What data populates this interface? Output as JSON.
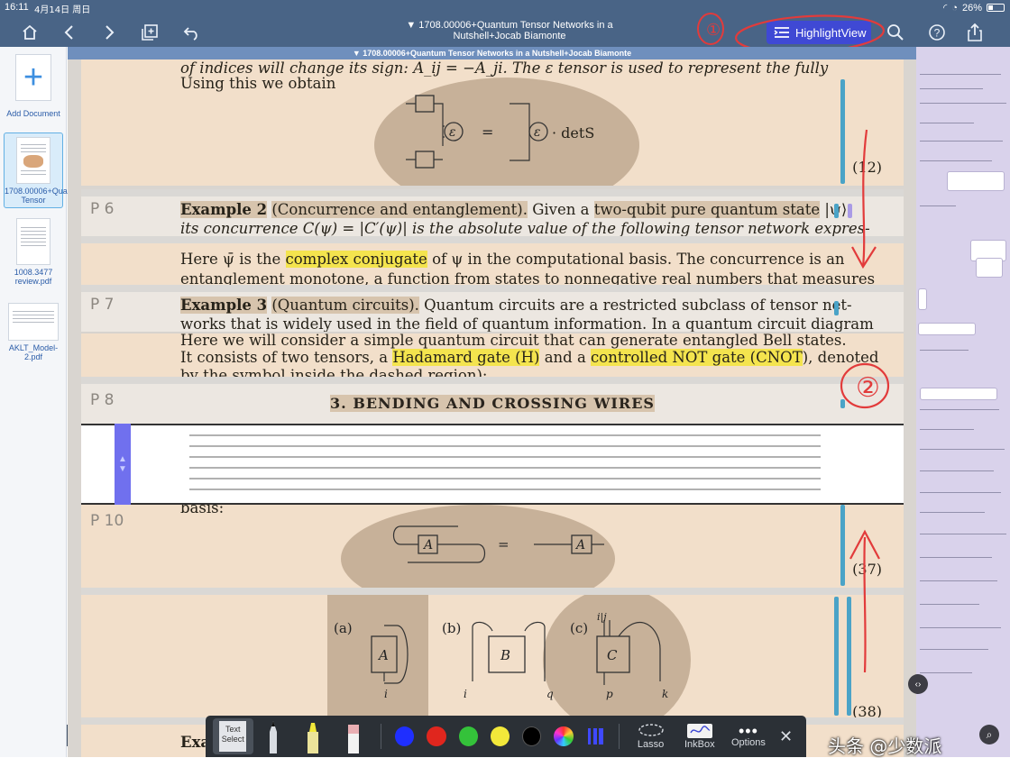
{
  "status": {
    "time": "16:11",
    "date": "4月14日 周日",
    "battery": "26%"
  },
  "toolbar": {
    "title_line1": "▼ 1708.00006+Quantum Tensor Networks in a",
    "title_line2": "Nutshell+Jocab Biamonte",
    "highlight_button": "HighlightView",
    "icons": [
      "home-icon",
      "chevron-left-icon",
      "chevron-right-icon",
      "add-page-icon",
      "undo-icon",
      "search-icon",
      "help-icon",
      "share-icon"
    ]
  },
  "sidebar": {
    "add_label": "Add Document",
    "documents": [
      {
        "label": "1708.00006+Quantum Tensor",
        "active": true
      },
      {
        "label": "1008.3477 review.pdf",
        "active": false
      },
      {
        "label": "AKLT_Model-2.pdf",
        "active": false
      }
    ]
  },
  "file_strip": "▼ 1708.00006+Quantum Tensor Networks in a Nutshell+Jocab Biamonte",
  "document": {
    "top_line": "of indices will change its sign: A_ij = −A_ji. The ε tensor is used to represent the fully",
    "using_line": "Using this we obtain",
    "eq12_label": "(12)",
    "eq12_rhs": "· detS",
    "p6": "P 6",
    "ex2_bold": "Example 2",
    "ex2_paren": "(Concurrence and entanglement).",
    "ex2_rest": "Given a",
    "ex2_hl": "two-qubit pure quantum state",
    "ex2_tail": "|ψ⟩,",
    "ex2_line2": "its concurrence C(ψ) = |C′(ψ)| is the absolute value of the following tensor network expres-",
    "here_pre": "Here ψ̄ is the",
    "here_hl": "complex conjugate",
    "here_post": "of ψ in the computational basis.  The concurrence is an",
    "here_line2": "entanglement monotone, a function from states to nonnegative real numbers that measures",
    "p7": "P 7",
    "ex3_bold": "Example 3",
    "ex3_paren": "(Quantum circuits).",
    "ex3_rest": "Quantum circuits are a restricted subclass of tensor net-",
    "ex3_line2": "works that is widely used in the field of quantum information.  In a quantum circuit diagram",
    "bell_line1": "    Here we will consider a simple quantum circuit that can generate entangled Bell states.",
    "bell_pre": "It consists of two tensors, a",
    "bell_hl1": "Hadamard gate (H)",
    "bell_mid": "and a",
    "bell_hl2": "controlled NOT gate (CNOT",
    "bell_post": "), denoted",
    "bell_line3": "by the symbol inside the dashed region):",
    "p8": "P 8",
    "section": "3.   BENDING AND CROSSING WIRES",
    "basis": "basis:",
    "p10": "P 10",
    "eq37_label": "(37)",
    "eq38_label": "(38)",
    "fig_a": "(a)",
    "fig_b": "(b)",
    "fig_c": "(c)",
    "A": "A",
    "B": "B",
    "C": "C",
    "i": "i",
    "q": "q",
    "p": "p",
    "k": "k",
    "ij": "i|j",
    "ex_bottom": "Exa"
  },
  "palette": {
    "text_select": "Text Select",
    "colors": [
      "#1f2fff",
      "#e0261e",
      "#34c23a",
      "#f2e83a",
      "#000000"
    ],
    "lasso": "Lasso",
    "inkbox": "InkBox",
    "options": "Options"
  },
  "annotations": {
    "circle1": "①",
    "circle2": "②"
  },
  "watermark": "头条 @少数派"
}
